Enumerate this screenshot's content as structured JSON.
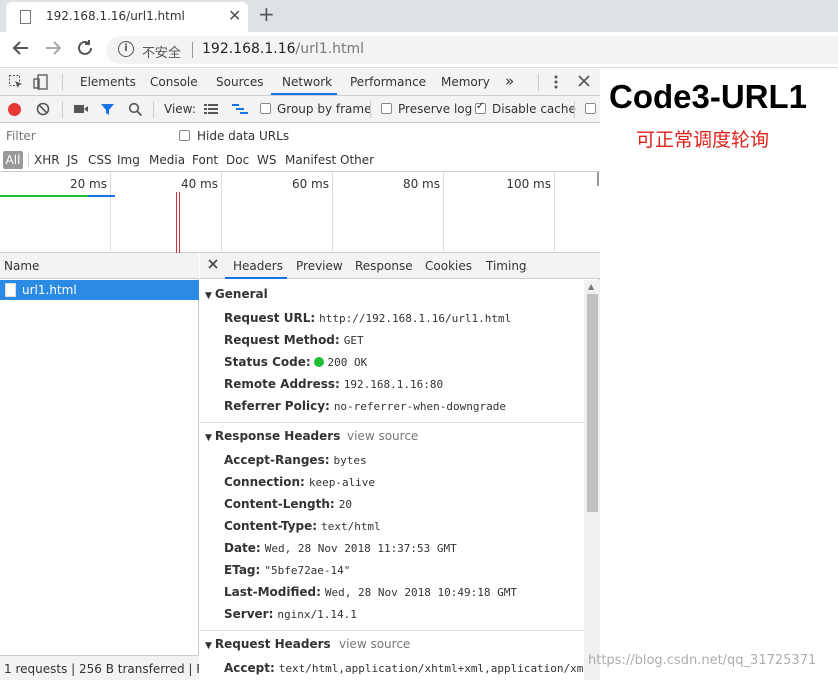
{
  "browser": {
    "tab_title": "192.168.1.16/url1.html",
    "close_tab": "✕",
    "new_tab": "+",
    "security_label": "不安全",
    "url_host": "192.168.1.16",
    "url_path": "/url1.html"
  },
  "devtools": {
    "tabs": [
      "Elements",
      "Console",
      "Sources",
      "Network",
      "Performance",
      "Memory"
    ],
    "more": "»",
    "active_tab": "Network",
    "toolbar": {
      "view_label": "View:",
      "group_by_frame": "Group by frame",
      "group_by_frame_checked": false,
      "preserve_log": "Preserve log",
      "preserve_log_checked": false,
      "disable_cache": "Disable cache",
      "disable_cache_checked": true
    },
    "filter": {
      "placeholder": "Filter",
      "hide_data_urls": "Hide data URLs"
    },
    "types": [
      "All",
      "XHR",
      "JS",
      "CSS",
      "Img",
      "Media",
      "Font",
      "Doc",
      "WS",
      "Manifest",
      "Other"
    ],
    "timeline_ticks": [
      "20 ms",
      "40 ms",
      "60 ms",
      "80 ms",
      "100 ms"
    ],
    "request_list": {
      "header": "Name",
      "requests": [
        "url1.html"
      ],
      "status": "1 requests | 256 B transferred | Fi..."
    },
    "detail_tabs": [
      "Headers",
      "Preview",
      "Response",
      "Cookies",
      "Timing"
    ],
    "active_detail_tab": "Headers",
    "general": {
      "title": "General",
      "rows": [
        {
          "k": "Request URL:",
          "v": "http://192.168.1.16/url1.html"
        },
        {
          "k": "Request Method:",
          "v": "GET"
        },
        {
          "k": "Status Code:",
          "v": "200 OK"
        },
        {
          "k": "Remote Address:",
          "v": "192.168.1.16:80"
        },
        {
          "k": "Referrer Policy:",
          "v": "no-referrer-when-downgrade"
        }
      ]
    },
    "response_headers": {
      "title": "Response Headers",
      "view_source": "view source",
      "rows": [
        {
          "k": "Accept-Ranges:",
          "v": "bytes"
        },
        {
          "k": "Connection:",
          "v": "keep-alive"
        },
        {
          "k": "Content-Length:",
          "v": "20"
        },
        {
          "k": "Content-Type:",
          "v": "text/html"
        },
        {
          "k": "Date:",
          "v": "Wed, 28 Nov 2018 11:37:53 GMT"
        },
        {
          "k": "ETag:",
          "v": "\"5bfe72ae-14\""
        },
        {
          "k": "Last-Modified:",
          "v": "Wed, 28 Nov 2018 10:49:18 GMT"
        },
        {
          "k": "Server:",
          "v": "nginx/1.14.1"
        }
      ]
    },
    "request_headers": {
      "title": "Request Headers",
      "view_source": "view source",
      "rows": [
        {
          "k": "Accept:",
          "v": "text/html,application/xhtml+xml,application/xm"
        }
      ]
    }
  },
  "page": {
    "title": "Code3-URL1",
    "subtitle": "可正常调度轮询"
  },
  "watermark": "https://blog.csdn.net/qq_31725371",
  "colors": {
    "record_red": "#e53935",
    "accent_blue": "#1a73e8",
    "selected_row": "#2b8ae3",
    "status_green": "#1fbf33",
    "subtitle_red": "#e0201a"
  }
}
